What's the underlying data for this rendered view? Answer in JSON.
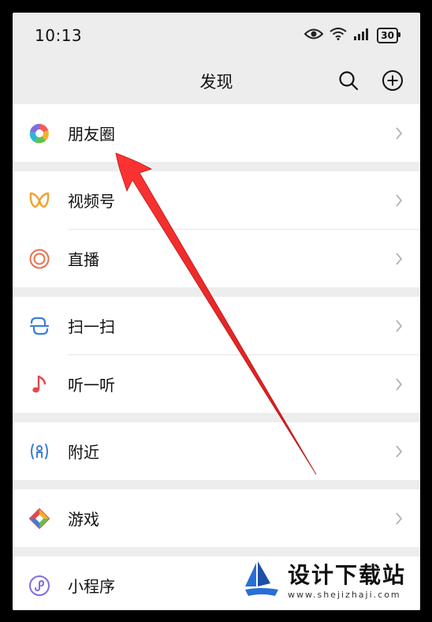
{
  "status_bar": {
    "time": "10:13",
    "battery": "30"
  },
  "nav": {
    "title": "发现"
  },
  "groups": [
    {
      "items": [
        {
          "label": "朋友圈",
          "icon": "moments-aperture-icon"
        }
      ]
    },
    {
      "items": [
        {
          "label": "视频号",
          "icon": "channels-butterfly-icon"
        },
        {
          "label": "直播",
          "icon": "live-circles-icon"
        }
      ]
    },
    {
      "items": [
        {
          "label": "扫一扫",
          "icon": "scan-icon"
        },
        {
          "label": "听一听",
          "icon": "music-note-icon"
        }
      ]
    },
    {
      "items": [
        {
          "label": "附近",
          "icon": "nearby-person-icon"
        }
      ]
    },
    {
      "items": [
        {
          "label": "游戏",
          "icon": "game-diamond-icon"
        }
      ]
    },
    {
      "items": [
        {
          "label": "小程序",
          "icon": "mini-program-icon"
        }
      ]
    }
  ],
  "watermark": {
    "title": "设计下载站",
    "url": "www.shejizhaji.com"
  },
  "colors": {
    "accent_arrow": "#e11b1b",
    "page_bg": "#ededed"
  }
}
